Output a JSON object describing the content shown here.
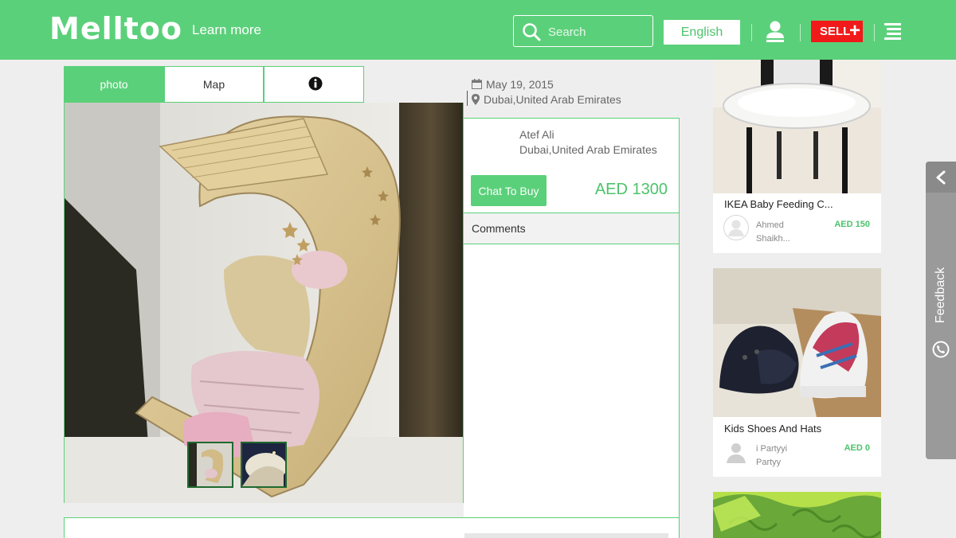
{
  "header": {
    "logo": "Melltoo",
    "learn_more": "Learn more",
    "search_placeholder": "Search",
    "language": "English",
    "sell_label": "SELL",
    "sell_plus": "+"
  },
  "tabs": [
    {
      "label": "photo",
      "active": true
    },
    {
      "label": "Map",
      "active": false
    },
    {
      "label": "",
      "icon": "info-icon",
      "active": false
    }
  ],
  "listing": {
    "date": "May 19, 2015",
    "location": "Dubai,United Arab Emirates",
    "seller_name": "Atef Ali",
    "seller_location": "Dubai,United Arab Emirates",
    "chat_button": "Chat To Buy",
    "price": "AED 1300",
    "comments_label": "Comments"
  },
  "cards": [
    {
      "title": "IKEA Baby Feeding C...",
      "user_line1": "Ahmed",
      "user_line2": "Shaikh...",
      "price": "AED 150"
    },
    {
      "title": "Kids Shoes And Hats",
      "user_line1": "i Partyyi",
      "user_line2": "Partyy",
      "price": "AED 0"
    }
  ],
  "feedback": {
    "label": "Feedback"
  },
  "colors": {
    "brand_green": "#5bd07a",
    "price_green": "#4cc36b",
    "sell_red": "#f11a1a",
    "feedback_grey": "#9a9a9a"
  }
}
